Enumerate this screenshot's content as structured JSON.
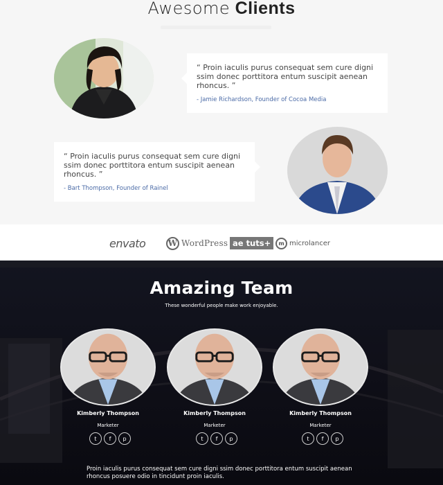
{
  "clients": {
    "title_thin": "Awesome",
    "title_bold": "Clients",
    "testimonials": [
      {
        "quote": "“ Proin iaculis purus consequat sem cure digni ssim donec porttitora entum suscipit aenean rhoncus. ”",
        "author": "- Jamie Richardson, Founder of Cocoa Media"
      },
      {
        "quote": "“ Proin iaculis purus consequat sem cure digni ssim donec porttitora entum suscipit aenean rhoncus. ”",
        "author": "- Bart Thompson, Founder of Rainel"
      }
    ]
  },
  "logos": {
    "envato": "envato",
    "wordpress": "WordPress",
    "tuts": "ae tuts+",
    "microlancer": "microlancer"
  },
  "team": {
    "title": "Amazing Team",
    "subtitle": "These wonderful people make work enjoyable.",
    "members": [
      {
        "name": "Kimberly Thompson",
        "role": "Marketer"
      },
      {
        "name": "Kimberly Thompson",
        "role": "Marketer"
      },
      {
        "name": "Kimberly Thompson",
        "role": "Marketer"
      }
    ],
    "social_icons": [
      "twitter-icon",
      "facebook-icon",
      "pinterest-icon"
    ],
    "description": "Proin iaculis purus consequat sem cure digni ssim donec porttitora entum suscipit aenean rhoncus posuere odio in tincidunt proin iaculis."
  }
}
